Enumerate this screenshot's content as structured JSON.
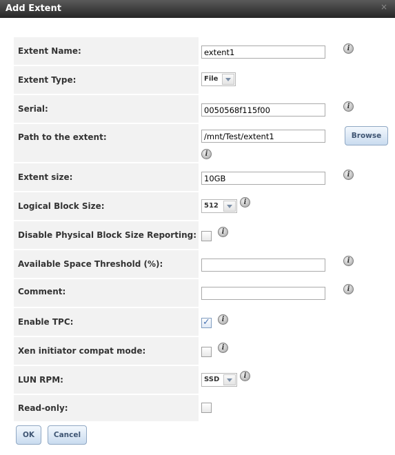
{
  "dialog": {
    "title": "Add Extent",
    "close_glyph": "×"
  },
  "fields": {
    "extent_name": {
      "label": "Extent Name:",
      "value": "extent1"
    },
    "extent_type": {
      "label": "Extent Type:",
      "value": "File"
    },
    "serial": {
      "label": "Serial:",
      "value": "0050568f115f00"
    },
    "path": {
      "label": "Path to the extent:",
      "value": "/mnt/Test/extent1",
      "browse_label": "Browse"
    },
    "extent_size": {
      "label": "Extent size:",
      "value": "10GB"
    },
    "logical_block_size": {
      "label": "Logical Block Size:",
      "value": "512"
    },
    "disable_physical_block": {
      "label": "Disable Physical Block Size Reporting:",
      "checked": false
    },
    "available_space_threshold": {
      "label": "Available Space Threshold (%):",
      "value": ""
    },
    "comment": {
      "label": "Comment:",
      "value": ""
    },
    "enable_tpc": {
      "label": "Enable TPC:",
      "checked": true
    },
    "xen_compat": {
      "label": "Xen initiator compat mode:",
      "checked": false
    },
    "lun_rpm": {
      "label": "LUN RPM:",
      "value": "SSD"
    },
    "read_only": {
      "label": "Read-only:",
      "checked": false
    }
  },
  "buttons": {
    "ok": "OK",
    "cancel": "Cancel"
  },
  "icons": {
    "info": "i",
    "check": "✓"
  }
}
